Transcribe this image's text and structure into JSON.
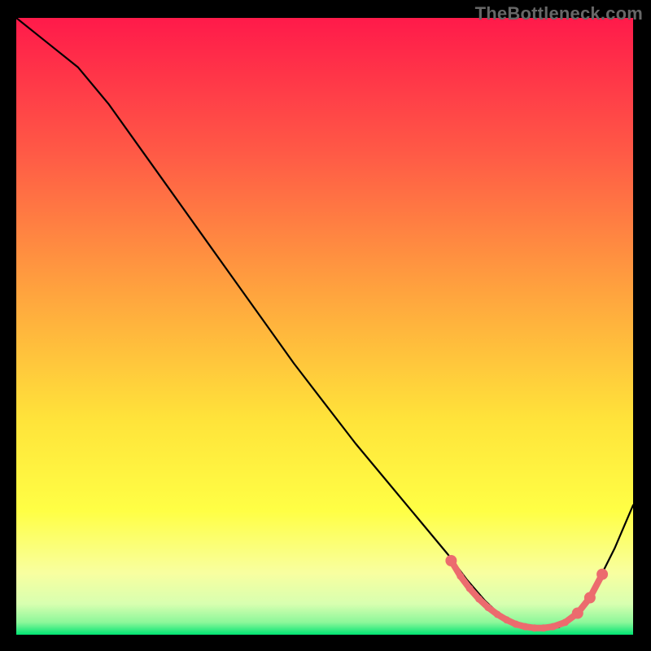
{
  "watermark": "TheBottleneck.com",
  "chart_data": {
    "type": "line",
    "xlim": [
      0,
      100
    ],
    "ylim": [
      0,
      100
    ],
    "title": "",
    "xlabel": "",
    "ylabel": "",
    "grid": false,
    "background_gradient": [
      "#ff1a4a",
      "#ff7845",
      "#ffca3a",
      "#ffff40",
      "#f9ff9c",
      "#c6ffb0",
      "#00e472"
    ],
    "curve": {
      "name": "bottleneck-curve",
      "color": "#000000",
      "x": [
        0,
        5,
        10,
        15,
        20,
        25,
        30,
        35,
        40,
        45,
        50,
        55,
        60,
        65,
        70,
        73,
        76,
        79,
        82,
        85,
        88,
        91,
        94,
        97,
        100
      ],
      "y": [
        100,
        96,
        92,
        86,
        79,
        72,
        65,
        58,
        51,
        44,
        37.5,
        31,
        25,
        19,
        13,
        9,
        5.5,
        2.7,
        1.2,
        1.0,
        1.2,
        3.5,
        8,
        14,
        21
      ]
    },
    "markers": {
      "name": "optimal-zone",
      "color": "#ec6b6e",
      "x": [
        70.5,
        72,
        73.5,
        75,
        76.5,
        78,
        79.5,
        81,
        82.5,
        84,
        85.5,
        87,
        89,
        91,
        93,
        95
      ],
      "y": [
        12.0,
        9.5,
        7.5,
        5.8,
        4.4,
        3.3,
        2.4,
        1.7,
        1.3,
        1.1,
        1.1,
        1.3,
        2.0,
        3.5,
        6.0,
        9.8
      ],
      "r_big": [
        true,
        false,
        false,
        false,
        false,
        false,
        false,
        false,
        false,
        false,
        false,
        false,
        false,
        true,
        true,
        true
      ],
      "line_width": 8,
      "dot_r_small": 4.5,
      "dot_r_big": 7
    },
    "green_band": {
      "y0": 0,
      "y1": 2.3
    }
  }
}
